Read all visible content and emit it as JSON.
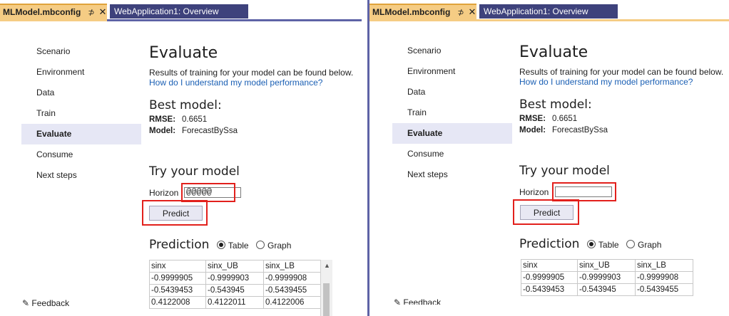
{
  "tabs": {
    "active_label": "MLModel.mbconfig",
    "pin_glyph": "⊅",
    "close_glyph": "✕",
    "inactive_label": "WebApplication1: Overview"
  },
  "nav": {
    "items": [
      "Scenario",
      "Environment",
      "Data",
      "Train",
      "Evaluate",
      "Consume",
      "Next steps"
    ],
    "active": "Evaluate"
  },
  "evaluate": {
    "title": "Evaluate",
    "description": "Results of training for your model can be found below.",
    "help_link": "How do I understand my model performance?"
  },
  "best_model": {
    "heading": "Best model:",
    "rmse_label": "RMSE:",
    "rmse_value": "0.6651",
    "model_label": "Model:",
    "model_value": "ForecastBySsa"
  },
  "try_model": {
    "heading": "Try your model",
    "horizon_label": "Horizon",
    "horizon_value_left": "@@@@@",
    "horizon_value_right": "",
    "predict_label": "Predict"
  },
  "prediction": {
    "heading": "Prediction",
    "option_table": "Table",
    "option_graph": "Graph",
    "selected": "Table",
    "columns": [
      "sinx",
      "sinx_UB",
      "sinx_LB"
    ],
    "rows_left": [
      [
        "-0.9999905",
        "-0.9999903",
        "-0.9999908"
      ],
      [
        "-0.5439453",
        "-0.543945",
        "-0.5439455"
      ],
      [
        "0.4122008",
        "0.4122011",
        "0.4122006"
      ]
    ],
    "rows_right": [
      [
        "-0.9999905",
        "-0.9999903",
        "-0.9999908"
      ],
      [
        "-0.5439453",
        "-0.543945",
        "-0.5439455"
      ]
    ]
  },
  "footer": {
    "feedback_left": "Feedback",
    "feedback_right": "Feedback"
  },
  "colors": {
    "tab_active": "#f5cc84",
    "tab_inactive": "#3e427c",
    "nav_active_bg": "#e6e7f5",
    "link": "#1a5fb4",
    "highlight_box": "#e2201c"
  }
}
